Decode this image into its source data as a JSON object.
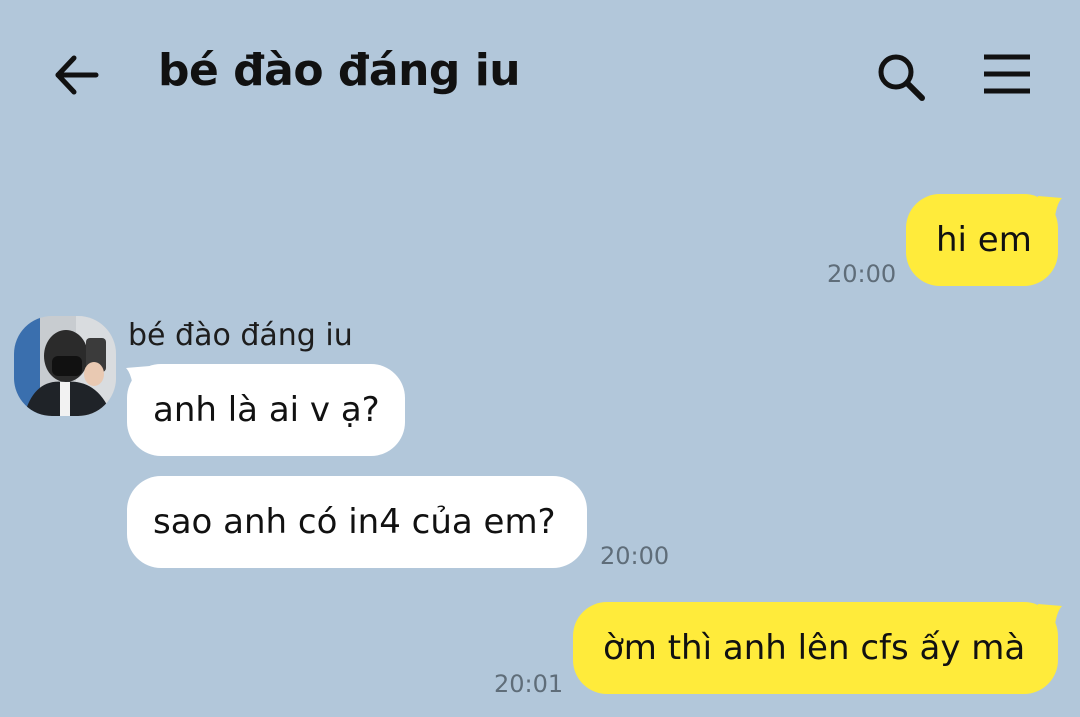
{
  "header": {
    "title": "bé đào đáng iu"
  },
  "icons": {
    "back": "arrow-left-icon",
    "search": "search-icon",
    "menu": "hamburger-menu-icon"
  },
  "colors": {
    "background": "#b2c7da",
    "outgoing_bubble": "#ffeb3b",
    "incoming_bubble": "#ffffff"
  },
  "messages": [
    {
      "direction": "outgoing",
      "text": "hi em",
      "time": "20:00"
    },
    {
      "direction": "incoming",
      "sender": "bé đào đáng iu",
      "text": "anh là ai v ạ?"
    },
    {
      "direction": "incoming",
      "text": "sao anh có in4 của em?",
      "time": "20:00"
    },
    {
      "direction": "outgoing",
      "text": "ờm thì anh lên cfs ấy mà",
      "time": "20:01"
    }
  ]
}
